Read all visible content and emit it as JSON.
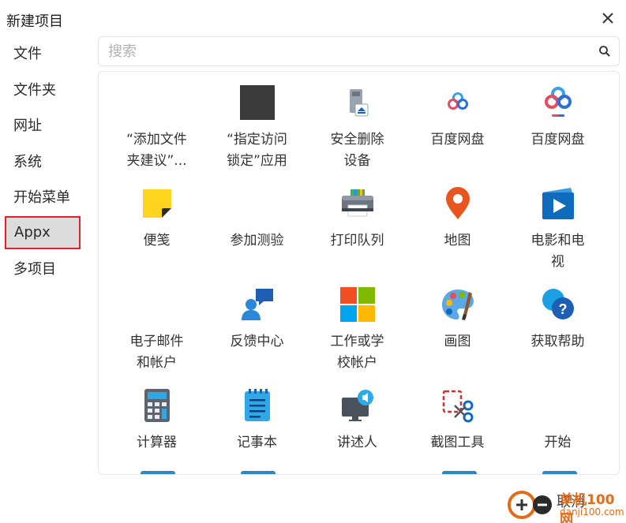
{
  "dialog": {
    "title": "新建项目",
    "close_icon": "close-icon"
  },
  "sidebar": {
    "items": [
      {
        "label": "文件"
      },
      {
        "label": "文件夹"
      },
      {
        "label": "网址"
      },
      {
        "label": "系统"
      },
      {
        "label": "开始菜单"
      },
      {
        "label": "Appx",
        "selected": true
      },
      {
        "label": "多项目"
      }
    ]
  },
  "search": {
    "placeholder": "搜索",
    "value": ""
  },
  "apps": [
    {
      "name": "“添加文件\n夹建议”...",
      "icon": "blank"
    },
    {
      "name": "“指定访问\n锁定”应用",
      "icon": "dark-square"
    },
    {
      "name": "安全删除\n设备",
      "icon": "usb-eject"
    },
    {
      "name": "百度网盘",
      "icon": "baidu-cloud"
    },
    {
      "name": "百度网盘",
      "icon": "baidu-cloud-large"
    },
    {
      "name": "便笺",
      "icon": "sticky-note"
    },
    {
      "name": "参加测验",
      "icon": "blank"
    },
    {
      "name": "打印队列",
      "icon": "printer"
    },
    {
      "name": "地图",
      "icon": "map-pin"
    },
    {
      "name": "电影和电\n视",
      "icon": "movies"
    },
    {
      "name": "电子邮件\n和帐户",
      "icon": "blank"
    },
    {
      "name": "反馈中心",
      "icon": "feedback"
    },
    {
      "name": "工作或学\n校帐户",
      "icon": "microsoft"
    },
    {
      "name": "画图",
      "icon": "paint"
    },
    {
      "name": "获取帮助",
      "icon": "get-help"
    },
    {
      "name": "计算器",
      "icon": "calculator"
    },
    {
      "name": "记事本",
      "icon": "notepad"
    },
    {
      "name": "讲述人",
      "icon": "narrator"
    },
    {
      "name": "截图工具",
      "icon": "snipping-tool"
    },
    {
      "name": "开始",
      "icon": "blank"
    }
  ],
  "watermark": {
    "cancel": "取消",
    "logo_text": "单机100网",
    "url": "danji100.com"
  },
  "colors": {
    "selected_border": "#e0212b",
    "selected_bg": "#dcdcdc"
  }
}
